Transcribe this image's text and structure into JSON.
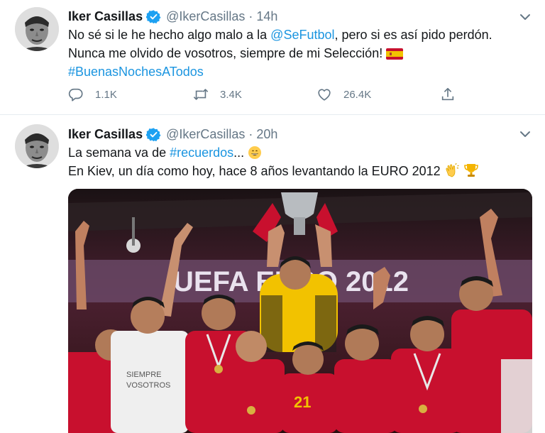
{
  "tweets": [
    {
      "author": "Iker Casillas",
      "handle": "@IkerCasillas",
      "separator": "·",
      "time": "14h",
      "lines": [
        {
          "pre": "No sé si le he hecho algo malo a la ",
          "mention": "@SeFutbol",
          "post": ", pero si es así pido perdón."
        },
        {
          "text": "Nunca me olvido de vosotros, siempre de mi Selección!"
        },
        {
          "hashtag": "#BuenasNochesATodos"
        }
      ],
      "emoji": [
        "spain-flag-emoji"
      ],
      "actions": {
        "replies": "1.1K",
        "retweets": "3.4K",
        "likes": "26.4K"
      }
    },
    {
      "author": "Iker Casillas",
      "handle": "@IkerCasillas",
      "separator": "·",
      "time": "20h",
      "lines": [
        {
          "pre": "La semana va de ",
          "hashtag": "#recuerdos",
          "post": "..."
        },
        {
          "text": "En Kiev, un día como hoy, hace 8 años levantando la EURO 2012"
        }
      ],
      "emoji": [
        "grinning-face-emoji",
        "clapping-hands-emoji",
        "trophy-emoji"
      ],
      "photo": {
        "banner_text": "UEFA EURO 2012",
        "jersey_number": "21",
        "shirt_text_line1": "SIEMPRE",
        "shirt_text_line2": "VOSOTROS"
      }
    }
  ],
  "colors": {
    "link": "#1b95e0",
    "secondary_text": "#657786",
    "verified_badge": "#1da1f2",
    "divider": "#e6ecf0",
    "spain_red": "#c8102e",
    "keeper_yellow": "#f2c200"
  }
}
